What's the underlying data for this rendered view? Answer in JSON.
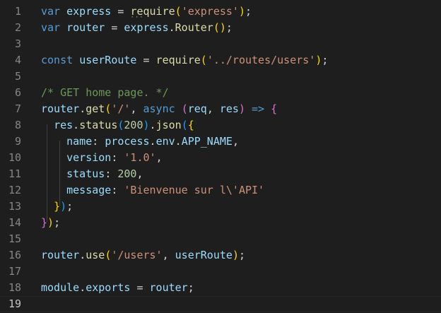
{
  "editor": {
    "language": "javascript",
    "current_line": 19,
    "colors": {
      "background": "#1e1e1e",
      "keyword": "#569cd6",
      "variable": "#9cdcfe",
      "function": "#dcdcaa",
      "string": "#ce9178",
      "number": "#b5cea8",
      "comment": "#6a9955",
      "line_number": "#858585"
    },
    "lines": [
      {
        "n": "1",
        "tokens": [
          [
            "k",
            "var"
          ],
          [
            "p",
            " "
          ],
          [
            "v",
            "express"
          ],
          [
            "p",
            " = "
          ],
          [
            "f",
            "require"
          ],
          [
            "c1",
            "("
          ],
          [
            "s",
            "'express'"
          ],
          [
            "c1",
            ")"
          ],
          [
            "p",
            ";"
          ]
        ]
      },
      {
        "n": "2",
        "tokens": [
          [
            "k",
            "var"
          ],
          [
            "p",
            " "
          ],
          [
            "v",
            "router"
          ],
          [
            "p",
            " = "
          ],
          [
            "v",
            "express"
          ],
          [
            "p",
            "."
          ],
          [
            "f",
            "Router"
          ],
          [
            "c1",
            "("
          ],
          [
            "c1",
            ")"
          ],
          [
            "p",
            ";"
          ]
        ]
      },
      {
        "n": "3",
        "tokens": []
      },
      {
        "n": "4",
        "tokens": [
          [
            "k",
            "const"
          ],
          [
            "p",
            " "
          ],
          [
            "v",
            "userRoute"
          ],
          [
            "p",
            " = "
          ],
          [
            "f",
            "require"
          ],
          [
            "c1",
            "("
          ],
          [
            "s",
            "'../routes/users'"
          ],
          [
            "c1",
            ")"
          ],
          [
            "p",
            ";"
          ]
        ]
      },
      {
        "n": "5",
        "tokens": []
      },
      {
        "n": "6",
        "tokens": [
          [
            "c",
            "/* GET home page. */"
          ]
        ]
      },
      {
        "n": "7",
        "tokens": [
          [
            "v",
            "router"
          ],
          [
            "p",
            "."
          ],
          [
            "f",
            "get"
          ],
          [
            "c1",
            "("
          ],
          [
            "s",
            "'/'"
          ],
          [
            "p",
            ", "
          ],
          [
            "k",
            "async"
          ],
          [
            "p",
            " "
          ],
          [
            "c2",
            "("
          ],
          [
            "v",
            "req"
          ],
          [
            "p",
            ", "
          ],
          [
            "v",
            "res"
          ],
          [
            "c2",
            ")"
          ],
          [
            "p",
            " "
          ],
          [
            "k",
            "=>"
          ],
          [
            "p",
            " "
          ],
          [
            "c2",
            "{"
          ]
        ]
      },
      {
        "n": "8",
        "tokens": [
          [
            "p",
            "  "
          ],
          [
            "v",
            "res"
          ],
          [
            "p",
            "."
          ],
          [
            "f",
            "status"
          ],
          [
            "c3",
            "("
          ],
          [
            "n",
            "200"
          ],
          [
            "c3",
            ")"
          ],
          [
            "p",
            "."
          ],
          [
            "f",
            "json"
          ],
          [
            "c3",
            "("
          ],
          [
            "c1",
            "{"
          ]
        ]
      },
      {
        "n": "9",
        "tokens": [
          [
            "p",
            "    "
          ],
          [
            "v",
            "name"
          ],
          [
            "p",
            ": "
          ],
          [
            "v",
            "process"
          ],
          [
            "p",
            "."
          ],
          [
            "v",
            "env"
          ],
          [
            "p",
            "."
          ],
          [
            "v",
            "APP_NAME"
          ],
          [
            "p",
            ","
          ]
        ]
      },
      {
        "n": "10",
        "tokens": [
          [
            "p",
            "    "
          ],
          [
            "v",
            "version"
          ],
          [
            "p",
            ": "
          ],
          [
            "s",
            "'1.0'"
          ],
          [
            "p",
            ","
          ]
        ]
      },
      {
        "n": "11",
        "tokens": [
          [
            "p",
            "    "
          ],
          [
            "v",
            "status"
          ],
          [
            "p",
            ": "
          ],
          [
            "n",
            "200"
          ],
          [
            "p",
            ","
          ]
        ]
      },
      {
        "n": "12",
        "tokens": [
          [
            "p",
            "    "
          ],
          [
            "v",
            "message"
          ],
          [
            "p",
            ": "
          ],
          [
            "s",
            "'Bienvenue sur l\\'API'"
          ]
        ]
      },
      {
        "n": "13",
        "tokens": [
          [
            "p",
            "  "
          ],
          [
            "c1",
            "}"
          ],
          [
            "c3",
            ")"
          ],
          [
            "p",
            ";"
          ]
        ]
      },
      {
        "n": "14",
        "tokens": [
          [
            "c2",
            "}"
          ],
          [
            "c1",
            ")"
          ],
          [
            "p",
            ";"
          ]
        ]
      },
      {
        "n": "15",
        "tokens": []
      },
      {
        "n": "16",
        "tokens": [
          [
            "v",
            "router"
          ],
          [
            "p",
            "."
          ],
          [
            "f",
            "use"
          ],
          [
            "c1",
            "("
          ],
          [
            "s",
            "'/users'"
          ],
          [
            "p",
            ", "
          ],
          [
            "v",
            "userRoute"
          ],
          [
            "c1",
            ")"
          ],
          [
            "p",
            ";"
          ]
        ]
      },
      {
        "n": "17",
        "tokens": []
      },
      {
        "n": "18",
        "tokens": [
          [
            "v",
            "module"
          ],
          [
            "p",
            "."
          ],
          [
            "v",
            "exports"
          ],
          [
            "p",
            " = "
          ],
          [
            "v",
            "router"
          ],
          [
            "p",
            ";"
          ]
        ]
      },
      {
        "n": "19",
        "tokens": []
      }
    ]
  }
}
